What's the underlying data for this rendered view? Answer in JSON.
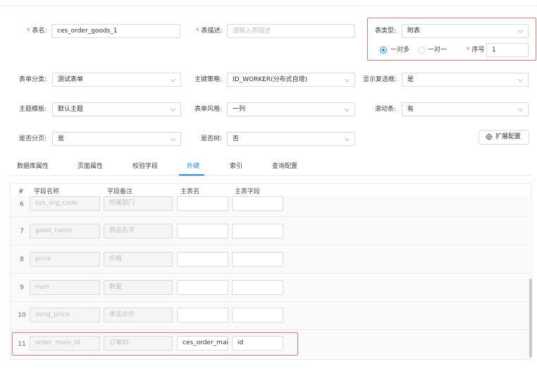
{
  "form": {
    "table_name": {
      "label": "表名:",
      "value": "ces_order_goods_1"
    },
    "table_desc": {
      "label": "表描述:",
      "placeholder": "请输入表描述"
    },
    "table_type": {
      "label": "表类型:",
      "value": "附表"
    },
    "relation": {
      "option_one_to_many": "一对多",
      "option_one_to_one": "一对一",
      "selected": "一对多"
    },
    "order": {
      "label": "序号",
      "value": "1"
    },
    "form_category": {
      "label": "表单分类:",
      "value": "测试表单"
    },
    "pk_strategy": {
      "label": "主键策略:",
      "value": "ID_WORKER(分布式自增)"
    },
    "show_checkbox": {
      "label": "显示复选框:",
      "value": "是"
    },
    "theme_template": {
      "label": "主题模板:",
      "value": "默认主题"
    },
    "form_style": {
      "label": "表单风格:",
      "value": "一列"
    },
    "scrollbar": {
      "label": "滚动条:",
      "value": "有"
    },
    "paging": {
      "label": "是否分页:",
      "value": "是"
    },
    "is_tree": {
      "label": "是否树:",
      "value": "否"
    },
    "extend_button": "扩展配置"
  },
  "tabs": [
    "数据库属性",
    "页面属性",
    "校验字段",
    "外键",
    "索引",
    "查询配置"
  ],
  "active_tab": "外键",
  "table": {
    "headers": [
      "#",
      "字段名称",
      "字段备注",
      "主表名",
      "主表字段"
    ],
    "rows": [
      {
        "num": "6",
        "name": "sys_org_code",
        "remark": "所属部门",
        "main_table": "",
        "main_field": ""
      },
      {
        "num": "7",
        "name": "good_name",
        "remark": "商品名字",
        "main_table": "",
        "main_field": ""
      },
      {
        "num": "8",
        "name": "price",
        "remark": "价格",
        "main_table": "",
        "main_field": ""
      },
      {
        "num": "9",
        "name": "num",
        "remark": "数量",
        "main_table": "",
        "main_field": ""
      },
      {
        "num": "10",
        "name": "zong_price",
        "remark": "单品总价",
        "main_table": "",
        "main_field": ""
      },
      {
        "num": "11",
        "name": "order_main_id",
        "remark": "订单ID",
        "main_table": "ces_order_mai",
        "main_field": "id"
      }
    ]
  },
  "colors": {
    "accent": "#1890ff",
    "required": "#ff4d4f",
    "highlight_border": "#e8777b"
  }
}
